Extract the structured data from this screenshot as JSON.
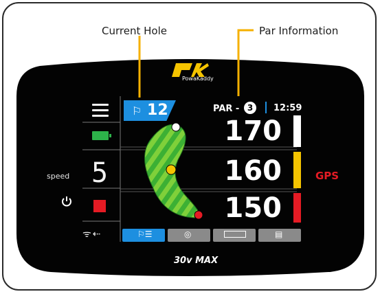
{
  "callouts": {
    "current_hole": "Current Hole",
    "par_information": "Par Information"
  },
  "brand": {
    "logo_name": "powakaddy-logo",
    "name": "PowaKaddy",
    "model": "30v MAX"
  },
  "sidebar": {
    "speed_label": "speed",
    "speed_value": "5",
    "battery_color": "#2db34a",
    "stop_color": "#e51b24"
  },
  "header": {
    "hole_number": "12",
    "par_label": "PAR -",
    "par_value": "3",
    "time": "12:59"
  },
  "distances": {
    "back": "170",
    "middle": "160",
    "front": "150"
  },
  "flag_colors": {
    "back": "#ffffff",
    "middle": "#f5c400",
    "front": "#e51b24"
  },
  "mode_label": "GPS",
  "tabs": [
    {
      "icon": "hole-list-icon",
      "active": true
    },
    {
      "icon": "distance-icon",
      "active": false
    },
    {
      "icon": "ruler-icon",
      "active": false
    },
    {
      "icon": "scorecard-icon",
      "active": false
    }
  ],
  "colors": {
    "accent": "#1d8fe0",
    "callout_line": "#f5b000"
  }
}
